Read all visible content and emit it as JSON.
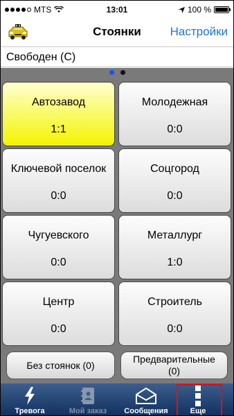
{
  "statusbar": {
    "carrier": "MTS",
    "time": "13:01",
    "battery": "100 %"
  },
  "navbar": {
    "title": "Стоянки",
    "settings_label": "Настройки"
  },
  "status": {
    "text": "Свободен (С)"
  },
  "pagination": {
    "current": 1,
    "total": 2
  },
  "parkings": [
    {
      "name": "Автозавод",
      "count": "1:1",
      "active": true
    },
    {
      "name": "Молодежная",
      "count": "0:0",
      "active": false
    },
    {
      "name": "Ключевой поселок",
      "count": "0:0",
      "active": false
    },
    {
      "name": "Соцгород",
      "count": "0:0",
      "active": false
    },
    {
      "name": "Чугуевского",
      "count": "0:0",
      "active": false
    },
    {
      "name": "Металлург",
      "count": "1:0",
      "active": false
    },
    {
      "name": "Центр",
      "count": "0:0",
      "active": false
    },
    {
      "name": "Строитель",
      "count": "0:0",
      "active": false
    }
  ],
  "bottom_buttons": {
    "no_parking": "Без стоянок (0)",
    "preliminary_line1": "Предварительные",
    "preliminary_line2": "(0)"
  },
  "tabs": [
    {
      "label": "Тревога",
      "icon": "lightning-icon",
      "enabled": true
    },
    {
      "label": "Мой заказ",
      "icon": "contacts-book-icon",
      "enabled": false
    },
    {
      "label": "Сообщения",
      "icon": "envelope-icon",
      "enabled": true
    },
    {
      "label": "Еще",
      "icon": "more-icon",
      "enabled": true
    }
  ],
  "colors": {
    "accent": "#1a73e8",
    "active_tile": "#f4f400",
    "grid_background": "#7a7a7a",
    "tabbar": "#1f3f6c",
    "highlight": "#e01010"
  }
}
